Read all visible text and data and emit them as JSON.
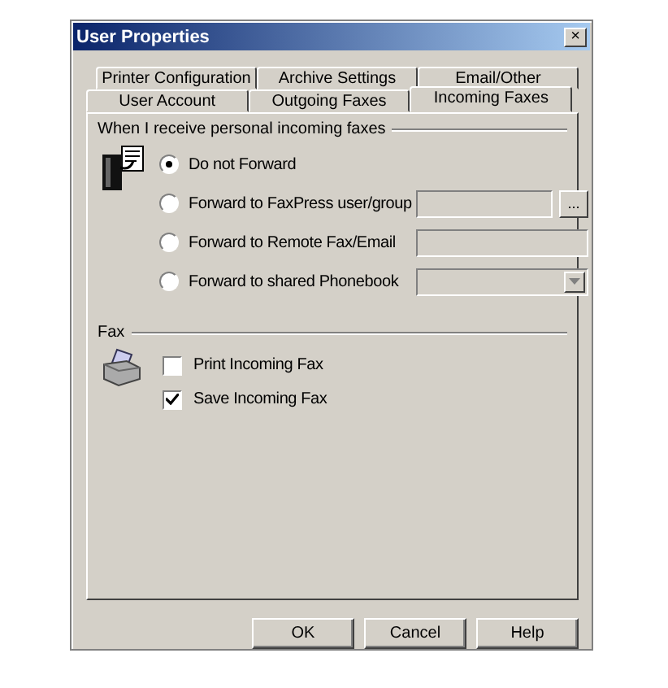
{
  "window": {
    "title": "User Properties",
    "close": "×"
  },
  "tab_rows": [
    [
      {
        "label": "Printer Configuration",
        "selected": false
      },
      {
        "label": "Archive Settings",
        "selected": false
      },
      {
        "label": "Email/Other",
        "selected": false
      }
    ],
    [
      {
        "label": "User Account",
        "selected": false
      },
      {
        "label": "Outgoing Faxes",
        "selected": false
      },
      {
        "label": "Incoming Faxes",
        "selected": true
      }
    ]
  ],
  "forward_group": {
    "title": "When I receive personal incoming faxes",
    "options": [
      {
        "label": "Do not Forward",
        "selected": true
      },
      {
        "label": "Forward to FaxPress user/group",
        "selected": false,
        "field": {
          "kind": "browse",
          "disabled": true,
          "button": "..."
        }
      },
      {
        "label": "Forward to Remote Fax/Email",
        "selected": false,
        "field": {
          "kind": "text",
          "disabled": true
        }
      },
      {
        "label": "Forward to shared Phonebook",
        "selected": false,
        "field": {
          "kind": "dropdown",
          "disabled": true
        }
      }
    ]
  },
  "fax_group": {
    "title": "Fax",
    "checkboxes": [
      {
        "label": "Print Incoming Fax",
        "checked": false
      },
      {
        "label": "Save Incoming Fax",
        "checked": true
      }
    ]
  },
  "buttons": [
    "OK",
    "Cancel",
    "Help"
  ]
}
